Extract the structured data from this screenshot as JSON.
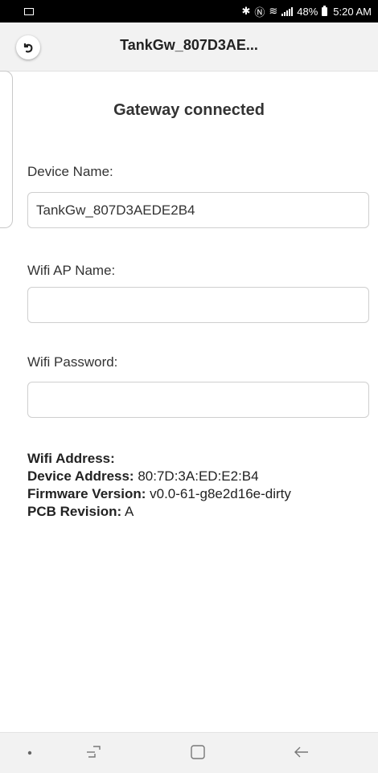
{
  "status_bar": {
    "right_text": "48%",
    "time": "5:20 AM"
  },
  "header": {
    "title": "TankGw_807D3AE..."
  },
  "main": {
    "status_heading": "Gateway connected",
    "device_name": {
      "label": "Device Name:",
      "value": "TankGw_807D3AEDE2B4"
    },
    "wifi_ap_name": {
      "label": "Wifi AP Name:",
      "value": ""
    },
    "wifi_password": {
      "label": "Wifi Password:",
      "value": ""
    }
  },
  "info": {
    "wifi_address_label": "Wifi Address:",
    "wifi_address_value": "",
    "device_address_label": "Device Address:",
    "device_address_value": "80:7D:3A:ED:E2:B4",
    "firmware_label": "Firmware Version:",
    "firmware_value": "v0.0-61-g8e2d16e-dirty",
    "pcb_label": "PCB Revision:",
    "pcb_value": "A"
  },
  "icons": {
    "back": "back-arrow-icon",
    "nav_dot": "dot-icon",
    "recents": "recent-apps-icon",
    "home": "home-icon",
    "back_nav": "back-nav-icon"
  }
}
